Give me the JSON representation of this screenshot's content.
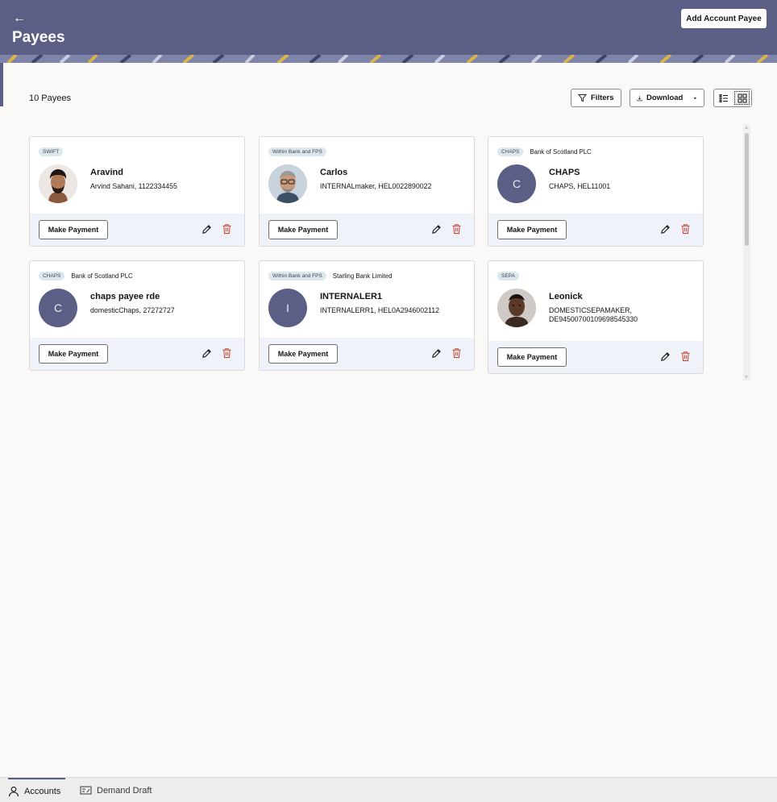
{
  "header": {
    "title": "Payees",
    "add_button": "Add Account Payee",
    "back_icon": "arrow-left-icon"
  },
  "toolbar": {
    "count_label": "10 Payees",
    "filters_label": "Filters",
    "download_label": "Download",
    "view_modes": [
      "list",
      "grid"
    ],
    "active_view": "grid"
  },
  "payees": [
    {
      "chip": "SWIFT",
      "bank": "",
      "name": "Aravind",
      "detail": "Arvind Sahani, 1122334455",
      "avatar": "photo",
      "initial": "",
      "action": "Make Payment"
    },
    {
      "chip": "Within Bank and FPS",
      "bank": "",
      "name": "Carlos",
      "detail": "INTERNALmaker, HEL0022890022",
      "avatar": "photo",
      "initial": "",
      "action": "Make Payment"
    },
    {
      "chip": "CHAPS",
      "bank": "Bank of Scotland PLC",
      "name": "CHAPS",
      "detail": "CHAPS, HEL11001",
      "avatar": "initial",
      "initial": "C",
      "action": "Make Payment"
    },
    {
      "chip": "CHAPS",
      "bank": "Bank of Scotland PLC",
      "name": "chaps payee rde",
      "detail": "domesticChaps, 27272727",
      "avatar": "initial",
      "initial": "C",
      "action": "Make Payment"
    },
    {
      "chip": "Within Bank and FPS",
      "bank": "Starling Bank Limited",
      "name": "INTERNALER1",
      "detail": "INTERNALERR1, HEL0A2946002112",
      "avatar": "initial",
      "initial": "I",
      "action": "Make Payment"
    },
    {
      "chip": "SEPA",
      "bank": "",
      "name": "Leonick",
      "detail": "DOMESTICSEPAMAKER, DE94500700109698545330",
      "avatar": "photo",
      "initial": "",
      "action": "Make Payment"
    }
  ],
  "bottom_nav": [
    {
      "label": "Accounts",
      "icon": "person-icon",
      "active": true
    },
    {
      "label": "Demand Draft",
      "icon": "draft-icon",
      "active": false
    }
  ],
  "colors": {
    "brand": "#5b5f86",
    "chip_bg": "#dde7ee",
    "footer_bg": "#f0f2f9",
    "delete": "#c74634"
  }
}
